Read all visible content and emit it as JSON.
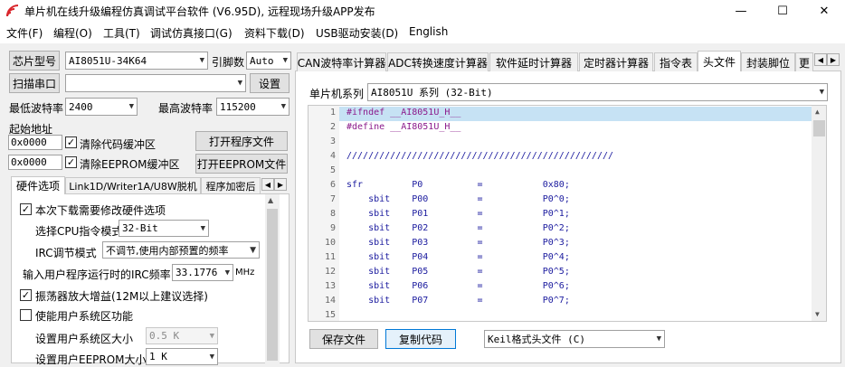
{
  "window": {
    "title": "单片机在线升级编程仿真调试平台软件 (V6.95D), 远程现场升级APP发布",
    "minimize": "—",
    "maximize": "☐",
    "close": "✕"
  },
  "menu": [
    "文件(F)",
    "编程(O)",
    "工具(T)",
    "调试仿真接口(G)",
    "资料下载(D)",
    "USB驱动安装(D)",
    "English"
  ],
  "left": {
    "chip_type_button": "芯片型号",
    "chip_model": "AI8051U-34K64",
    "pin_label": "引脚数",
    "pin_value": "Auto",
    "scan_port_button": "扫描串口",
    "port_value": "",
    "settings_button": "设置",
    "min_baud_label": "最低波特率",
    "min_baud_value": "2400",
    "max_baud_label": "最高波特率",
    "max_baud_value": "115200",
    "start_addr_label": "起始地址",
    "code_addr": "0x0000",
    "clear_code_label": "清除代码缓冲区",
    "clear_code_checked": true,
    "open_program_button": "打开程序文件",
    "eeprom_addr": "0x0000",
    "clear_eeprom_label": "清除EEPROM缓冲区",
    "clear_eeprom_checked": true,
    "open_eeprom_button": "打开EEPROM文件",
    "tabs": [
      "硬件选项",
      "Link1D/Writer1A/U8W脱机",
      "程序加密后"
    ],
    "hw": {
      "modify_hw_label": "本次下载需要修改硬件选项",
      "modify_hw_checked": true,
      "cpu_mode_label": "选择CPU指令模式",
      "cpu_mode_value": "32-Bit",
      "irc_mode_label": "IRC调节模式",
      "irc_mode_value": "不调节,使用内部预置的频率",
      "irc_freq_label": "输入用户程序运行时的IRC频率",
      "irc_freq_value": "33.1776",
      "irc_freq_unit": "MHz",
      "osc_gain_label": "振荡器放大增益(12M以上建议选择)",
      "osc_gain_checked": true,
      "user_sys_label": "使能用户系统区功能",
      "user_sys_checked": false,
      "user_sys_size_label": "设置用户系统区大小",
      "user_sys_size_value": "0.5 K",
      "user_eeprom_label": "设置用户EEPROM大小",
      "user_eeprom_value": "1   K"
    }
  },
  "right": {
    "tabs": [
      "CAN波特率计算器",
      "ADC转换速度计算器",
      "软件延时计算器",
      "定时器计算器",
      "指令表",
      "头文件",
      "封装脚位",
      "更"
    ],
    "active_tab": 5,
    "mcu_series_label": "单片机系列",
    "mcu_series_value": "AI8051U 系列 (32-Bit)",
    "code_lines": [
      "#ifndef __AI8051U_H__",
      "#define __AI8051U_H__",
      "",
      "/////////////////////////////////////////////////",
      "",
      "sfr         P0          =           0x80;",
      "    sbit    P00         =           P0^0;",
      "    sbit    P01         =           P0^1;",
      "    sbit    P02         =           P0^2;",
      "    sbit    P03         =           P0^3;",
      "    sbit    P04         =           P0^4;",
      "    sbit    P05         =           P0^5;",
      "    sbit    P06         =           P0^6;",
      "    sbit    P07         =           P0^7;",
      ""
    ],
    "save_button": "保存文件",
    "copy_button": "复制代码",
    "format_value": "Keil格式头文件 (C)"
  }
}
